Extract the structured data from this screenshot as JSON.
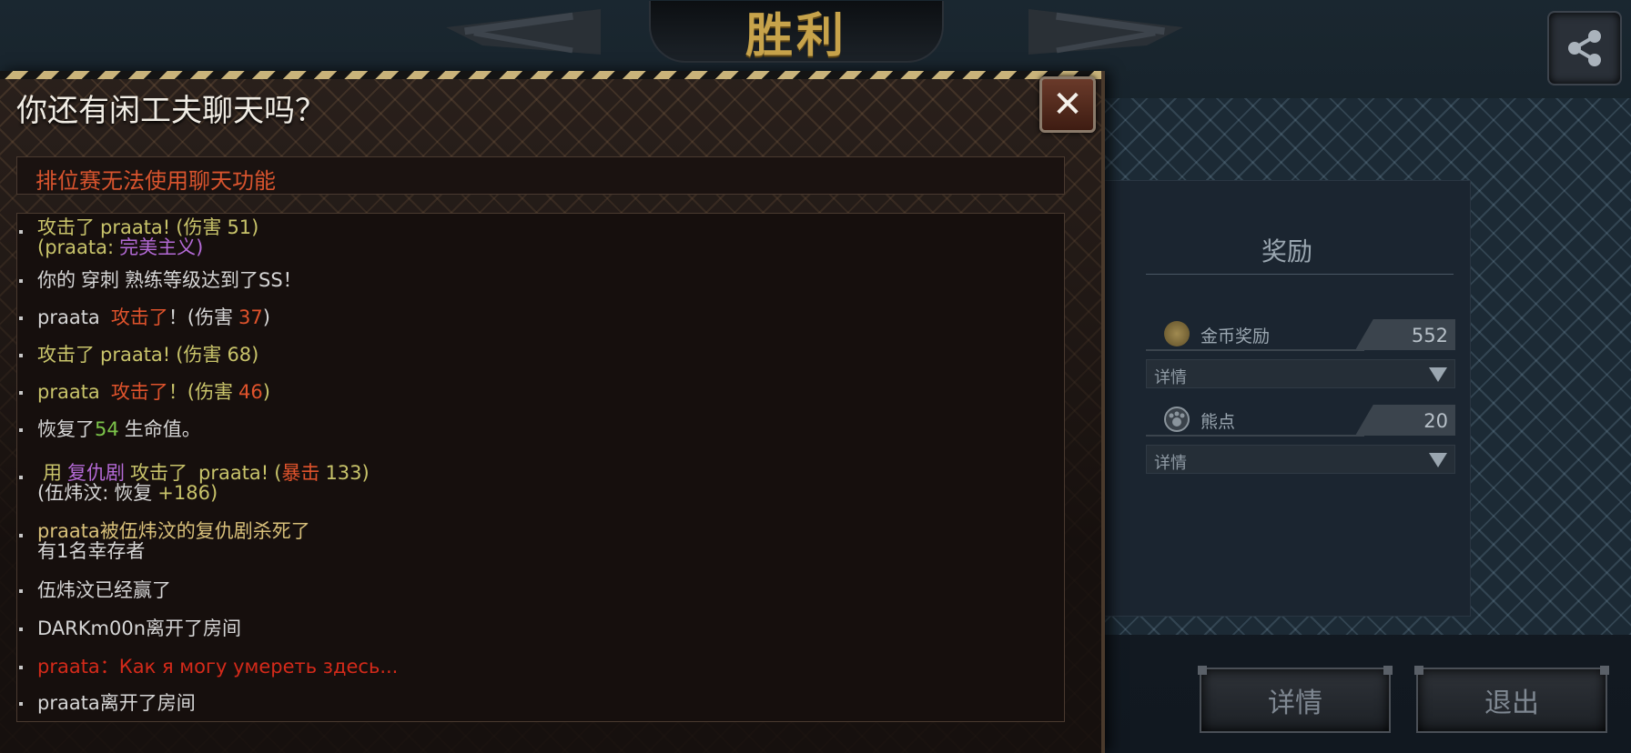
{
  "header": {
    "victory_title": "胜利"
  },
  "rewards": {
    "title": "奖励",
    "gold": {
      "label": "金币奖励",
      "value": "552",
      "detail": "详情"
    },
    "bear": {
      "label": "熊点",
      "value": "20",
      "detail": "详情"
    }
  },
  "buttons": {
    "details": "详情",
    "exit": "退出"
  },
  "chat": {
    "title": "你还有闲工夫聊天吗？",
    "close_symbol": "✕",
    "notice": "排位赛无法使用聊天功能",
    "messages": {
      "m1": {
        "a": "攻击了",
        "b": "praata!",
        "c": "(伤害",
        "d": "51)",
        "e": "(praata:",
        "f": "完美主义)"
      },
      "m2": {
        "a": "你的",
        "b": "穿刺",
        "c": "熟练等级达到了SS！"
      },
      "m3": {
        "a": "praata",
        "b": "攻击了",
        "c": "！(伤害",
        "d": "37",
        "e": ")"
      },
      "m4": {
        "a": "攻击了",
        "b": "praata!",
        "c": "(伤害",
        "d": "68",
        "e": ")"
      },
      "m5": {
        "a": "praata",
        "b": "攻击了",
        "c": "！(伤害",
        "d": "46",
        "e": ")"
      },
      "m6": {
        "a": "恢复了",
        "b": "54",
        "c": "生命值。"
      },
      "m7": {
        "a": "用",
        "b": "复仇剧",
        "c": "攻击了",
        "d": "praata!",
        "e": "(",
        "f": "暴击",
        "g": "133)",
        "h": "(伍炜汶:",
        "i": "恢复",
        "j": "+186)"
      },
      "m8": {
        "a": "praata",
        "b": "被伍炜汶的复仇剧杀死了",
        "c": "有1名幸存者"
      },
      "m9": {
        "a": "伍炜汶已经赢了"
      },
      "m10": {
        "a": "DARKm00n离开了房间"
      },
      "m11": {
        "a": "praata：Как я могу умереть здесь..."
      },
      "m12": {
        "a": "praata离开了房间"
      }
    }
  },
  "colors": {
    "victory_gold": "#c7a34b",
    "notice_red": "#d8542e",
    "damage_orange": "#e0532c",
    "skill_purple": "#b46ad6",
    "heal_green": "#7cc44a",
    "player_yellow": "#c8c36a",
    "russian_red": "#d42a1a"
  },
  "icons": [
    "share-icon",
    "close-icon",
    "gold-coin-icon",
    "bear-paw-icon",
    "dropdown-arrow-icon"
  ]
}
